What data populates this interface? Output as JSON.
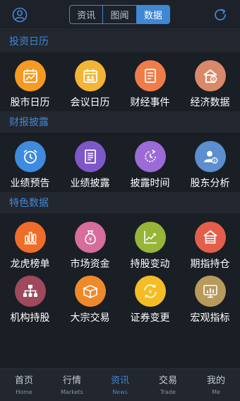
{
  "header": {
    "segments": [
      {
        "label": "资讯",
        "active": false
      },
      {
        "label": "图闻",
        "active": false
      },
      {
        "label": "数据",
        "active": true
      }
    ],
    "left_icon": "user-icon",
    "right_icon": "refresh-icon"
  },
  "sections": [
    {
      "title": "投资日历",
      "items": [
        {
          "label": "股市日历",
          "icon": "stock-calendar-icon",
          "color": "#f59a23"
        },
        {
          "label": "会议日历",
          "icon": "meeting-calendar-icon",
          "color": "#f4b436"
        },
        {
          "label": "财经事件",
          "icon": "finance-event-icon",
          "color": "#ee7d4a"
        },
        {
          "label": "经济数据",
          "icon": "economic-data-icon",
          "color": "#d9896a"
        }
      ]
    },
    {
      "title": "财报披露",
      "items": [
        {
          "label": "业绩预告",
          "icon": "alarm-clock-icon",
          "color": "#3e8be0"
        },
        {
          "label": "业绩披露",
          "icon": "document-icon",
          "color": "#7e58c7"
        },
        {
          "label": "披露时间",
          "icon": "clock-icon",
          "color": "#9b6bd6"
        },
        {
          "label": "股东分析",
          "icon": "shareholder-icon",
          "color": "#5b8fcf"
        }
      ]
    },
    {
      "title": "特色数据",
      "items": [
        {
          "label": "龙虎榜单",
          "icon": "bar-chart-icon",
          "color": "#ee6d2b"
        },
        {
          "label": "市场资金",
          "icon": "money-bag-icon",
          "color": "#d66d9c"
        },
        {
          "label": "持股变动",
          "icon": "trend-chart-icon",
          "color": "#98b53a"
        },
        {
          "label": "期指持仓",
          "icon": "warehouse-icon",
          "color": "#e45f4b"
        },
        {
          "label": "机构持股",
          "icon": "org-chart-icon",
          "color": "#9e4a5c"
        },
        {
          "label": "大宗交易",
          "icon": "box-icon",
          "color": "#ef8a2c"
        },
        {
          "label": "证券变更",
          "icon": "exchange-icon",
          "color": "#f5bd25"
        },
        {
          "label": "宏观指标",
          "icon": "monitor-icon",
          "color": "#b79a5c"
        }
      ]
    }
  ],
  "tabbar": [
    {
      "label": "首页",
      "sub": "Home",
      "active": false
    },
    {
      "label": "行情",
      "sub": "Markets",
      "active": false
    },
    {
      "label": "资讯",
      "sub": "News",
      "active": true
    },
    {
      "label": "交易",
      "sub": "Trade",
      "active": false
    },
    {
      "label": "我的",
      "sub": "Me",
      "active": false
    }
  ]
}
